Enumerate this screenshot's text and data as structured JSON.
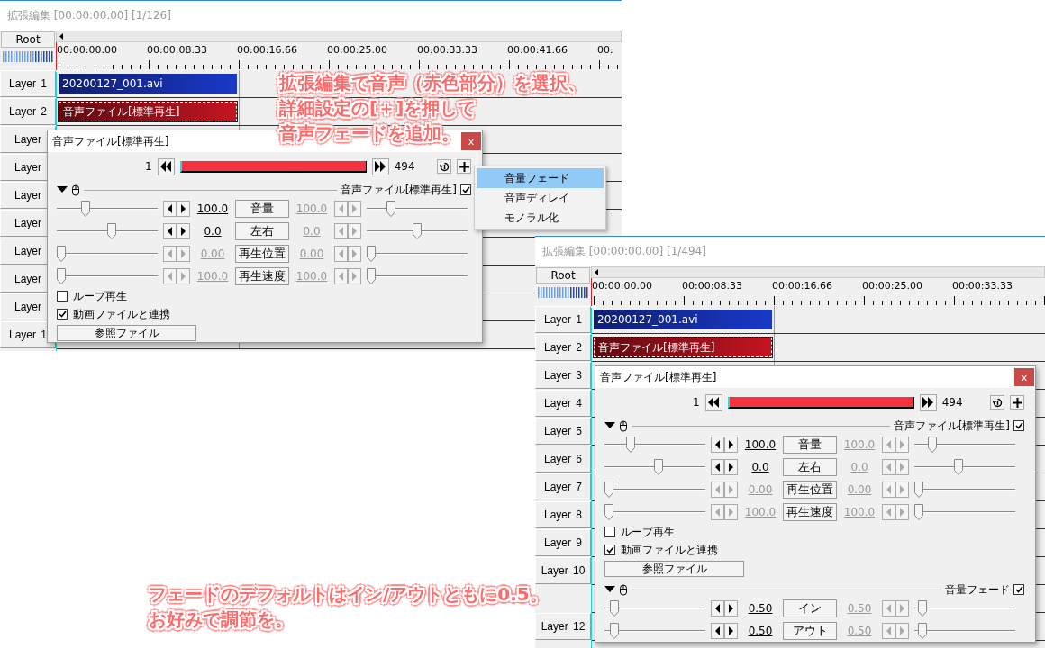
{
  "windows": [
    {
      "title": "拡張編集 [00:00:00.00] [1/126]",
      "root": "Root",
      "ruler": [
        "00:00:00.00",
        "00:00:08.33",
        "00:00:16.66",
        "00:00:25.00",
        "00:00:33.33",
        "00:00:41.66",
        "00:"
      ],
      "layers": [
        {
          "kind": "layer",
          "label": "Layer 1",
          "clip": {
            "kind": "video",
            "text": "20200127_001.avi",
            "selected": false
          }
        },
        {
          "kind": "layer",
          "label": "Layer 2",
          "clip": {
            "kind": "audio",
            "text": "音声ファイル[標準再生]",
            "selected": true
          }
        },
        {
          "kind": "layer",
          "label": "Layer"
        },
        {
          "kind": "layer",
          "label": "Layer"
        },
        {
          "kind": "layer",
          "label": "Layer"
        },
        {
          "kind": "layer",
          "label": "Layer"
        },
        {
          "kind": "layer",
          "label": "Layer"
        },
        {
          "kind": "layer",
          "label": "Layer"
        },
        {
          "kind": "layer",
          "label": "Layer"
        },
        {
          "kind": "layer",
          "label": "Layer 1"
        }
      ],
      "dialog": {
        "title": "音声ファイル[標準再生]",
        "close": "x",
        "start_frame": "1",
        "end_frame": "494",
        "controls": [
          {
            "kind": "header",
            "label": "音声ファイル[標準再生]",
            "checked": true
          },
          {
            "kind": "track",
            "name": "音量",
            "start": {
              "value": "100.0",
              "level": 0.26,
              "disabled": false
            },
            "end": {
              "value": "100.0",
              "level": 0.22,
              "disabled": true
            }
          },
          {
            "kind": "track",
            "name": "左右",
            "start": {
              "value": "0.0",
              "level": 0.55,
              "disabled": false
            },
            "end": {
              "value": "0.0",
              "level": 0.5,
              "disabled": true
            }
          },
          {
            "kind": "track",
            "name": "再生位置",
            "start": {
              "value": "0.00",
              "level": 0,
              "disabled": true
            },
            "end": {
              "value": "0.00",
              "level": 0,
              "disabled": true
            }
          },
          {
            "kind": "track",
            "name": "再生速度",
            "start": {
              "value": "100.0",
              "level": 0,
              "disabled": true
            },
            "end": {
              "value": "100.0",
              "level": 0,
              "disabled": true
            }
          },
          {
            "kind": "checkbox",
            "label": "ループ再生",
            "checked": false
          },
          {
            "kind": "checkbox",
            "label": "動画ファイルと連携",
            "checked": true
          },
          {
            "kind": "button",
            "label": "参照ファイル"
          }
        ]
      },
      "menu": {
        "items": [
          {
            "label": "音量フェード",
            "selected": true
          },
          {
            "label": "音声ディレイ",
            "selected": false
          },
          {
            "label": "モノラル化",
            "selected": false
          }
        ]
      }
    },
    {
      "title": "拡張編集 [00:00:00.00] [1/494]",
      "root": "Root",
      "ruler": [
        "00:00:00.00",
        "00:00:08.33",
        "00:00:16.66",
        "00:00:25.00",
        "00:00:33.33"
      ],
      "layers": [
        {
          "kind": "layer",
          "label": "Layer 1",
          "clip": {
            "kind": "video",
            "text": "20200127_001.avi",
            "selected": false
          }
        },
        {
          "kind": "layer",
          "label": "Layer 2",
          "clip": {
            "kind": "audio",
            "text": "音声ファイル[標準再生]",
            "selected": true
          }
        },
        {
          "kind": "layer",
          "label": "Layer 3"
        },
        {
          "kind": "layer",
          "label": "Layer 4"
        },
        {
          "kind": "layer",
          "label": "Layer 5"
        },
        {
          "kind": "layer",
          "label": "Layer 6"
        },
        {
          "kind": "layer",
          "label": "Layer 7"
        },
        {
          "kind": "layer",
          "label": "Layer 8"
        },
        {
          "kind": "layer",
          "label": "Layer 9"
        },
        {
          "kind": "layer",
          "label": "Layer 10"
        },
        {
          "kind": "blank"
        },
        {
          "kind": "layer",
          "label": "Layer 12"
        }
      ],
      "dialog": {
        "title": "音声ファイル[標準再生]",
        "close": "x",
        "start_frame": "1",
        "end_frame": "494",
        "controls": [
          {
            "kind": "header",
            "label": "音声ファイル[標準再生]",
            "checked": true
          },
          {
            "kind": "track",
            "name": "音量",
            "start": {
              "value": "100.0",
              "level": 0.24,
              "disabled": false
            },
            "end": {
              "value": "100.0",
              "level": 0.15,
              "disabled": true
            }
          },
          {
            "kind": "track",
            "name": "左右",
            "start": {
              "value": "0.0",
              "level": 0.54,
              "disabled": false
            },
            "end": {
              "value": "0.0",
              "level": 0.43,
              "disabled": true
            }
          },
          {
            "kind": "track",
            "name": "再生位置",
            "start": {
              "value": "0.00",
              "level": 0,
              "disabled": true
            },
            "end": {
              "value": "0.00",
              "level": 0,
              "disabled": true
            }
          },
          {
            "kind": "track",
            "name": "再生速度",
            "start": {
              "value": "100.0",
              "level": 0,
              "disabled": true
            },
            "end": {
              "value": "100.0",
              "level": 0,
              "disabled": true
            }
          },
          {
            "kind": "checkbox",
            "label": "ループ再生",
            "checked": false
          },
          {
            "kind": "checkbox",
            "label": "動画ファイルと連携",
            "checked": true
          },
          {
            "kind": "button",
            "label": "参照ファイル"
          },
          {
            "kind": "header",
            "label": "音量フェード",
            "checked": true
          },
          {
            "kind": "track",
            "name": "イン",
            "start": {
              "value": "0.50",
              "level": 0.06,
              "disabled": false
            },
            "end": {
              "value": "0.50",
              "level": 0.04,
              "disabled": true
            }
          },
          {
            "kind": "track",
            "name": "アウト",
            "start": {
              "value": "0.50",
              "level": 0.06,
              "disabled": false
            },
            "end": {
              "value": "0.50",
              "level": 0.04,
              "disabled": true
            }
          }
        ]
      }
    }
  ],
  "annotations": [
    {
      "lines": [
        "拡張編集で音声（赤色部分）を選択、",
        "詳細設定の[＋]を押して",
        "音声フェードを追加。"
      ]
    },
    {
      "lines": [
        "フェードのデフォルトはイン/アウトともに0.5。",
        "お好みで調節を。"
      ]
    }
  ]
}
